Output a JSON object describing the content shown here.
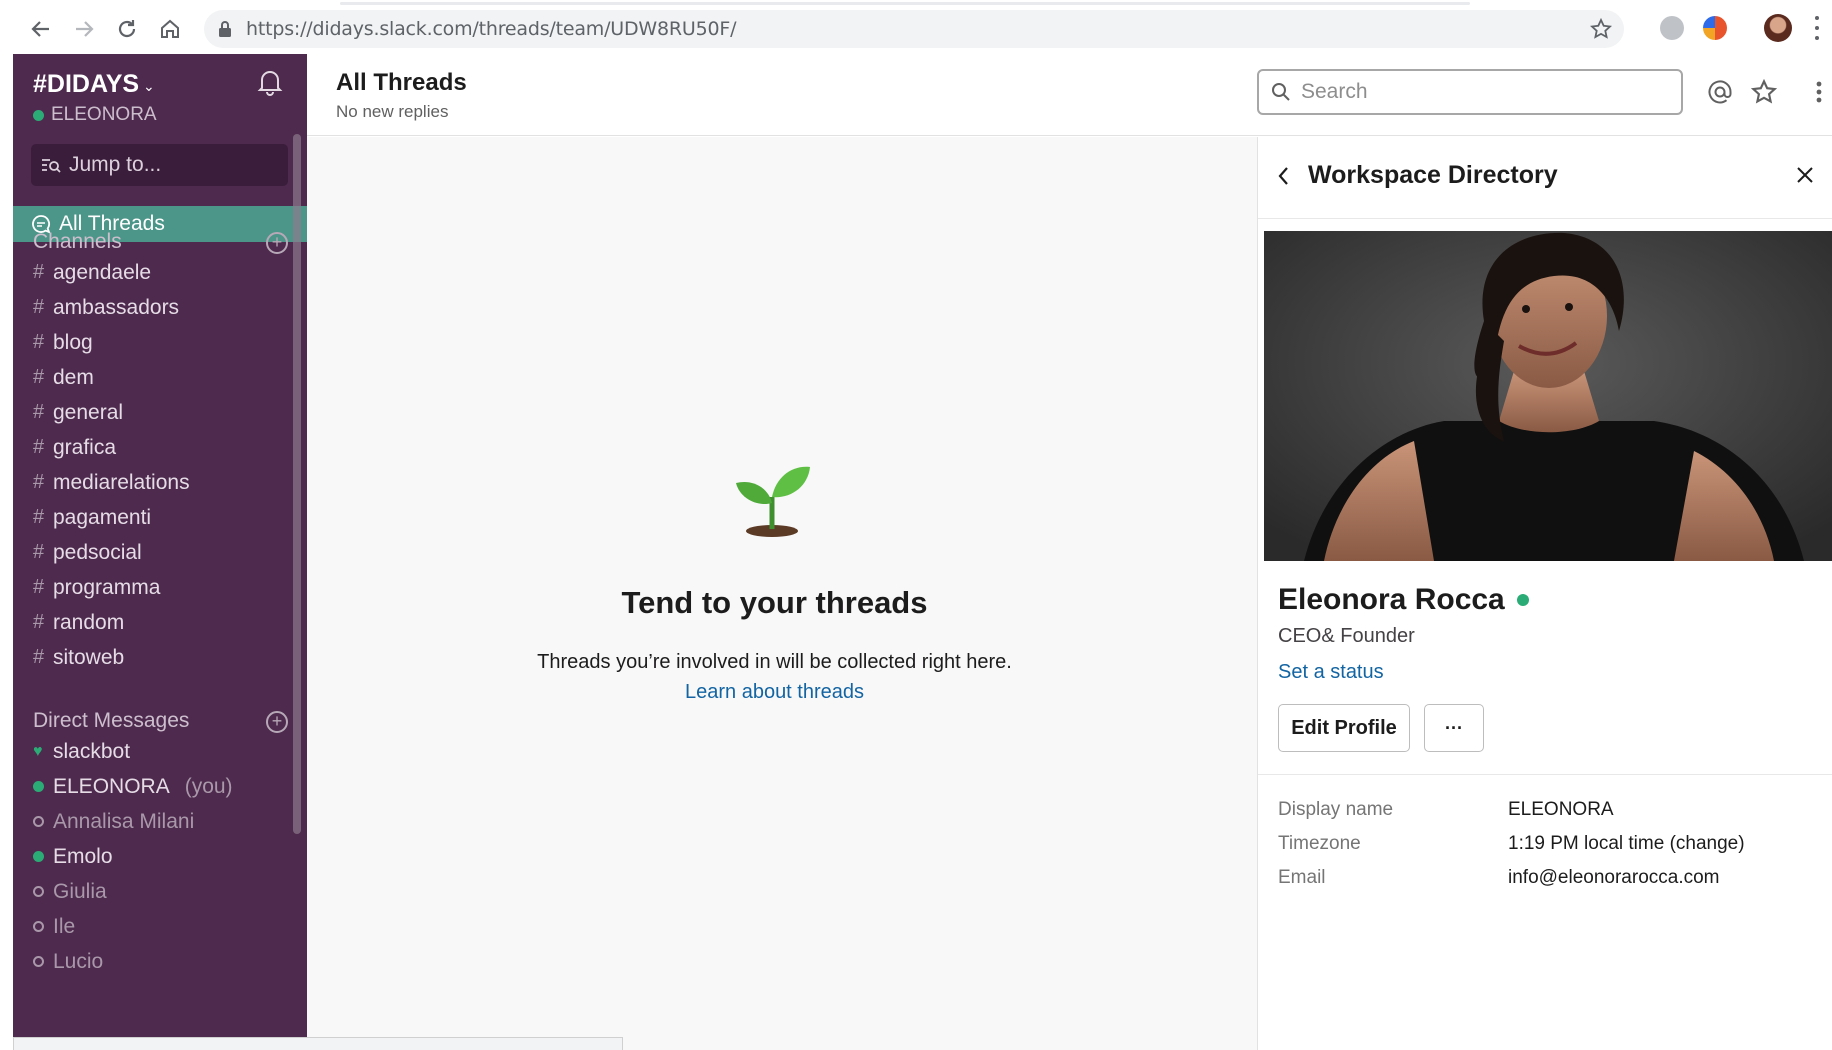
{
  "browser": {
    "url": "https://didays.slack.com/threads/team/UDW8RU50F/"
  },
  "sidebar": {
    "workspace": "#DIDAYS",
    "user": "ELEONORA",
    "jump_to": "Jump to...",
    "all_threads": "All Threads",
    "channels_label": "Channels",
    "channels": [
      "agendaele",
      "ambassadors",
      "blog",
      "dem",
      "general",
      "grafica",
      "mediarelations",
      "pagamenti",
      "pedsocial",
      "programma",
      "random",
      "sitoweb"
    ],
    "dm_label": "Direct Messages",
    "dms": [
      {
        "name": "slackbot",
        "status": "bot"
      },
      {
        "name": "ELEONORA",
        "suffix": "(you)",
        "status": "online"
      },
      {
        "name": "Annalisa Milani",
        "status": "away"
      },
      {
        "name": "Emolo",
        "status": "online"
      },
      {
        "name": "Giulia",
        "status": "away"
      },
      {
        "name": "Ile",
        "status": "away"
      },
      {
        "name": "Lucio",
        "status": "away"
      }
    ]
  },
  "header": {
    "title": "All Threads",
    "subtitle": "No new replies",
    "search_placeholder": "Search"
  },
  "main": {
    "empty_title": "Tend to your threads",
    "empty_text": "Threads you’re involved in will be collected right here.",
    "empty_link": "Learn about threads"
  },
  "panel": {
    "title": "Workspace Directory",
    "name": "Eleonora Rocca",
    "role": "CEO& Founder",
    "set_status": "Set a status",
    "edit_profile": "Edit Profile",
    "more": "···",
    "fields": [
      {
        "key": "Display name",
        "value": "ELEONORA"
      },
      {
        "key": "Timezone",
        "value": "1:19 PM local time (change)"
      },
      {
        "key": "Email",
        "value": "info@eleonorarocca.com"
      }
    ]
  },
  "colors": {
    "sidebar_bg": "#4d2a4e",
    "active_item": "#4c9689",
    "online": "#2bac76",
    "link": "#1264a3"
  }
}
